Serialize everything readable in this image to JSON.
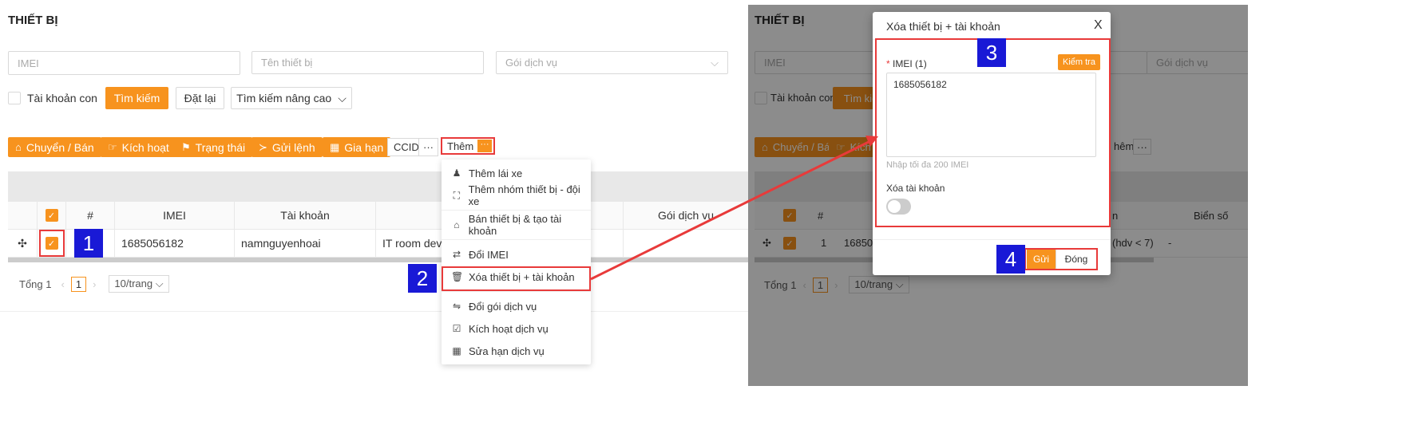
{
  "left": {
    "title": "THIẾT BỊ",
    "imei_placeholder": "IMEI",
    "name_placeholder": "Tên thiết bị",
    "service_placeholder": "Gói dịch vụ",
    "sub_account": "Tài khoản con",
    "search": "Tìm kiếm",
    "reset": "Đặt lại",
    "advanced": "Tìm kiếm nâng cao",
    "toolbar": {
      "transfer": "Chuyển / Bán",
      "activate": "Kích hoạt",
      "status": "Trạng thái",
      "send_cmd": "Gửi lệnh",
      "extend": "Gia hạn",
      "ccid": "CCID",
      "more": "Thêm",
      "dots": "···"
    },
    "table": {
      "headers": [
        "#",
        "IMEI",
        "Tài khoản",
        "T",
        "Gói dịch vụ"
      ],
      "row": {
        "imei": "1685056182",
        "account": "namnguyenhoai",
        "name": "IT room devic"
      }
    },
    "pagination": {
      "total": "Tổng 1",
      "page": "1",
      "size": "10/trang"
    },
    "menu": [
      {
        "label": "Thêm lái xe",
        "icon": "user-icon"
      },
      {
        "label": "Thêm nhóm thiết bị - đội xe",
        "icon": "group-icon"
      },
      {
        "label": "Bán thiết bị & tạo tài khoản",
        "icon": "shop-icon"
      },
      {
        "label": "Đổi IMEI",
        "icon": "swap-icon"
      },
      {
        "label": "Xóa thiết bị + tài khoản",
        "icon": "trash-icon"
      },
      {
        "label": "Đổi gói dịch vụ",
        "icon": "exchange-icon"
      },
      {
        "label": "Kích hoạt dịch vụ",
        "icon": "check-icon"
      },
      {
        "label": "Sửa hạn dịch vụ",
        "icon": "calendar-icon"
      }
    ]
  },
  "badges": [
    "1",
    "2",
    "3",
    "4"
  ],
  "right": {
    "title": "THIẾT BỊ",
    "imei_placeholder": "IMEI",
    "service_placeholder": "Gói dịch vụ",
    "sub_account": "Tài khoản con",
    "search_partial": "Tìm kiế",
    "transfer": "Chuyển / Bán",
    "activate_partial": "Kích",
    "more_partial": "hêm",
    "dots": "···",
    "headers": {
      "hash": "#",
      "col_partial": "n",
      "plate": "Biển số"
    },
    "row": {
      "num": "1",
      "imei_partial": "16850",
      "hdv": "(hdv < 7)",
      "plate": "-"
    },
    "pagination": {
      "total": "Tổng 1",
      "page": "1",
      "size": "10/trang"
    }
  },
  "modal": {
    "title": "Xóa thiết bị + tài khoản",
    "close": "X",
    "imei_label": "IMEI (1)",
    "required_mark": "*",
    "check_btn": "Kiểm tra",
    "imei_value": "1685056182",
    "hint": "Nhập tối đa 200 IMEI",
    "delete_account_label": "Xóa tài khoản",
    "send": "Gửi",
    "close_btn": "Đóng"
  },
  "colors": {
    "accent": "#f7931e",
    "annotation": "#e83a3a",
    "badge": "#1919d6"
  }
}
